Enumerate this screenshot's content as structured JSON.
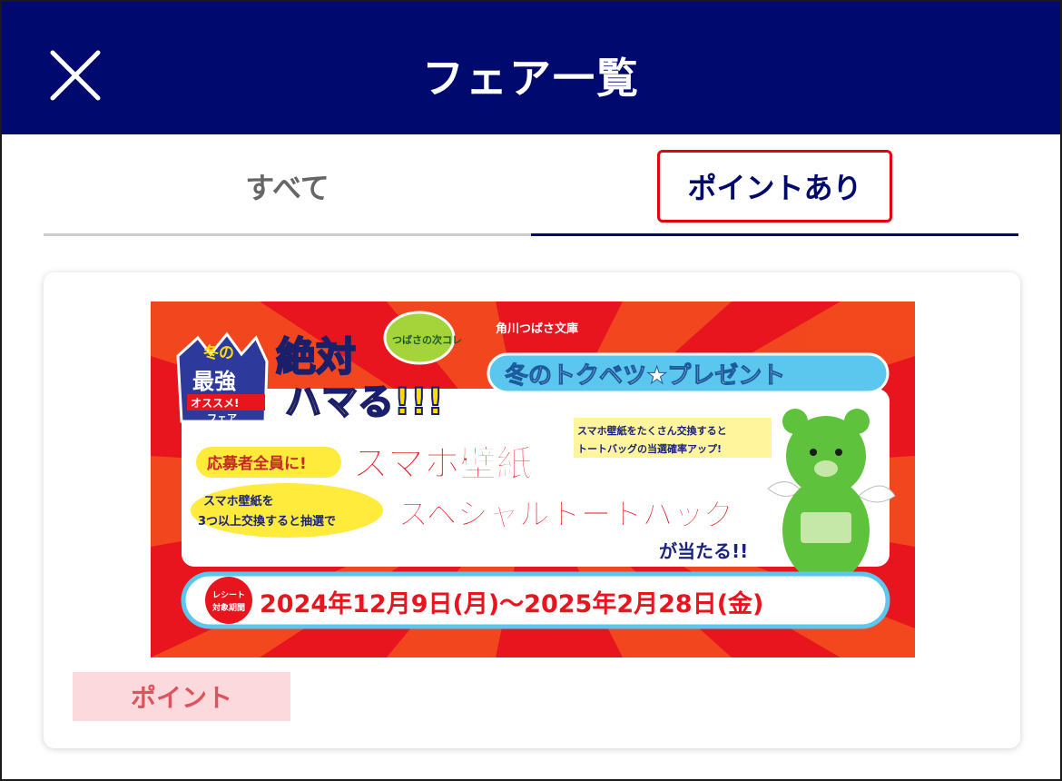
{
  "header": {
    "title": "フェア一覧",
    "close_icon": "close-icon"
  },
  "tabs": [
    {
      "label": "すべて",
      "selected": false
    },
    {
      "label": "ポイントあり",
      "selected": true
    }
  ],
  "fair_card": {
    "banner": {
      "publisher": "角川つばさ文庫",
      "fair_badge_line1": "冬の",
      "fair_badge_line2": "最強",
      "fair_badge_line3": "オススメ!",
      "fair_badge_line4": "フェア",
      "headline_1": "絶対",
      "headline_2": "ハマる!!!",
      "series_logo": "つばさの次コレ",
      "campaign_title": "冬のトクベツ★プレゼント",
      "note": "スマホ壁紙をたくさん交換すると",
      "note_2": "トートバッグの当選確率アップ!",
      "tag_1": "応募者全員に!",
      "prize_1": "スマホ壁紙",
      "tag_2a": "スマホ壁紙を",
      "tag_2b": "3つ以上交換すると抽選で",
      "prize_2": "スペシャルトートバッグ",
      "prize_2_suffix": "が当たる!!",
      "period_label_1": "レシート",
      "period_label_2": "対象期間",
      "period": "2024年12月9日(月)～2025年2月28日(金)"
    },
    "badge_label": "ポイント"
  },
  "colors": {
    "header_bg": "#000a6e",
    "highlight_border": "#e60012",
    "badge_bg": "#fcd9dc",
    "badge_text": "#e0525c",
    "banner_red": "#e8141e",
    "bear_green": "#5ec23c"
  }
}
